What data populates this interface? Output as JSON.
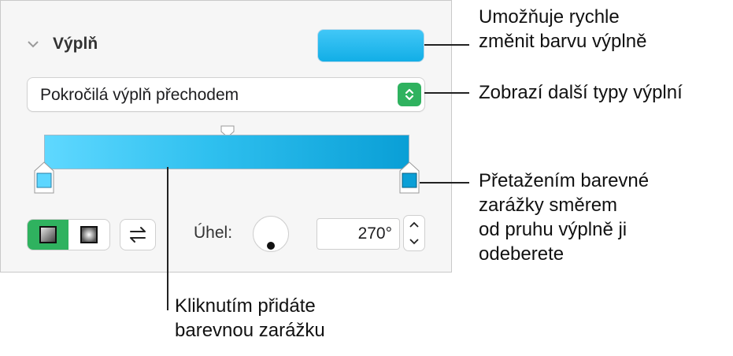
{
  "panel": {
    "section": {
      "title": "Výplň",
      "expanded": true
    },
    "fill_color": "#1cb7ed",
    "fill_type_select": {
      "value": "Pokročilá výplň přechodem"
    },
    "gradient": {
      "stops": [
        {
          "color": "#5cd6ff"
        },
        {
          "color": "#0a9fd6"
        }
      ]
    },
    "gradient_kind": {
      "options": [
        "linear-icon",
        "radial-icon"
      ],
      "selected": "linear-icon"
    },
    "angle": {
      "label": "Úhel:",
      "value": "270°"
    }
  },
  "callouts": {
    "color_well": [
      "Umožňuje rychle",
      "změnit barvu výplně"
    ],
    "fill_types": [
      "Zobrazí další typy výplní"
    ],
    "color_stop": [
      "Přetažením barevné",
      "zarážky směrem",
      "od pruhu výplně ji",
      "odeberete"
    ],
    "add_stop": [
      "Kliknutím přidáte",
      "barevnou zarážku"
    ]
  },
  "colors": {
    "accent": "#2fb25f",
    "panel_bg": "#f6f6f6",
    "line": "#222222"
  }
}
